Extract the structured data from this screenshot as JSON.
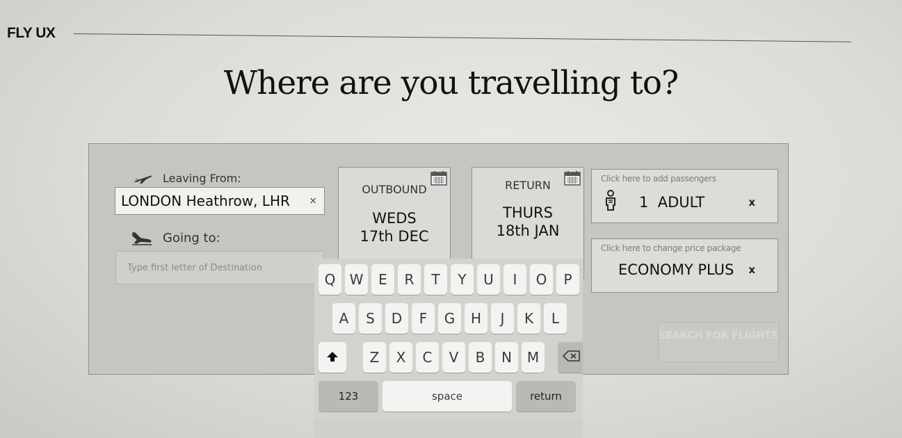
{
  "brand": "FLY UX",
  "headline": "Where are you travelling to?",
  "leaving": {
    "label": "Leaving From:",
    "value": "LONDON Heathrow, LHR",
    "clear": "×"
  },
  "going": {
    "label": "Going to:",
    "placeholder": "Type first letter of Destination"
  },
  "outbound": {
    "caption": "OUTBOUND",
    "line1": "WEDS",
    "line2": "17th DEC"
  },
  "return": {
    "caption": "RETURN",
    "line1": "THURS",
    "line2": "18th JAN"
  },
  "passengers": {
    "hint": "Click here to add passengers",
    "value": "1  ADULT",
    "clear": "x"
  },
  "package": {
    "hint": "Click here to change price package",
    "value": "ECONOMY PLUS",
    "clear": "x"
  },
  "search_button": "SEARCH FOR FLIGHTS",
  "keyboard": {
    "row1": [
      "Q",
      "W",
      "E",
      "R",
      "T",
      "Y",
      "U",
      "I",
      "O",
      "P"
    ],
    "row2": [
      "A",
      "S",
      "D",
      "F",
      "G",
      "H",
      "J",
      "K",
      "L"
    ],
    "row3": [
      "Z",
      "X",
      "C",
      "V",
      "B",
      "N",
      "M"
    ],
    "numbers": "123",
    "space": "space",
    "return": "return"
  },
  "icons": {
    "takeoff": "plane-takeoff-icon",
    "landing": "plane-landing-icon",
    "calendar": "calendar-icon",
    "person": "person-icon",
    "shift": "shift-icon",
    "backspace": "backspace-icon"
  }
}
